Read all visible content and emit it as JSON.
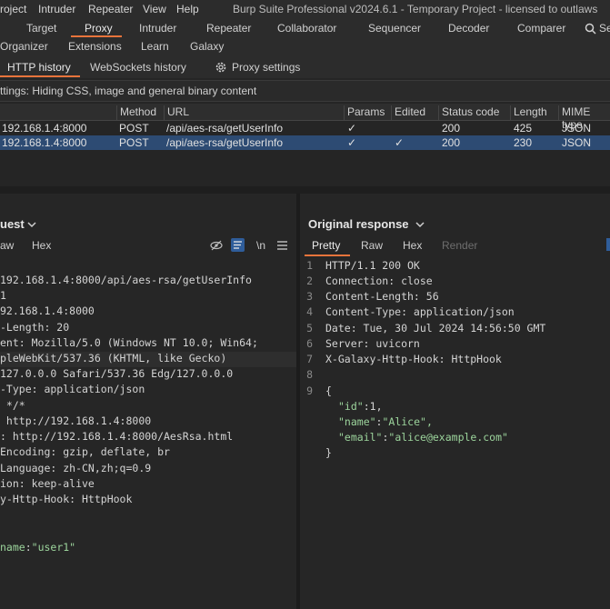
{
  "menu": {
    "items": [
      "roject",
      "Intruder",
      "Repeater",
      "View",
      "Help"
    ],
    "title": "Burp Suite Professional v2024.6.1 - Temporary Project - licensed to outlaws"
  },
  "top_tabs": {
    "items": [
      "Target",
      "Proxy",
      "Intruder",
      "Repeater",
      "Collaborator",
      "Sequencer",
      "Decoder",
      "Comparer"
    ],
    "search_text": "Se"
  },
  "sub_tabs": [
    "Organizer",
    "Extensions",
    "Learn",
    "Galaxy"
  ],
  "proxy_tabs": {
    "http_history": "HTTP history",
    "websockets": "WebSockets history",
    "settings": "Proxy settings"
  },
  "filter_text": "ttings: Hiding CSS, image and general binary content",
  "history_table": {
    "headers": [
      "Method",
      "URL",
      "Params",
      "Edited",
      "Status code",
      "Length",
      "MIME type"
    ],
    "rows": [
      {
        "host": "192.168.1.4:8000",
        "method": "POST",
        "url": "/api/aes-rsa/getUserInfo",
        "params": "✓",
        "edited": "",
        "status": "200",
        "length": "425",
        "mime": "JSON"
      },
      {
        "host": "192.168.1.4:8000",
        "method": "POST",
        "url": "/api/aes-rsa/getUserInfo",
        "params": "✓",
        "edited": "✓",
        "status": "200",
        "length": "230",
        "mime": "JSON"
      }
    ]
  },
  "request_pane": {
    "title": "uest",
    "tabs": [
      "aw",
      "Hex"
    ],
    "wrap_icon_text": "\\n",
    "lines": [
      "192.168.1.4:8000/api/aes-rsa/getUserInfo",
      "1",
      "92.168.1.4:8000",
      "-Length: 20",
      "ent: Mozilla/5.0 (Windows NT 10.0; Win64;",
      "pleWebKit/537.36 (KHTML, like Gecko)",
      "127.0.0.0 Safari/537.36 Edg/127.0.0.0",
      "-Type: application/json",
      " */*",
      " http://192.168.1.4:8000",
      ": http://192.168.1.4:8000/AesRsa.html",
      "Encoding: gzip, deflate, br",
      "Language: zh-CN,zh;q=0.9",
      "ion: keep-alive",
      "y-Http-Hook: HttpHook"
    ],
    "body_key": "name",
    "body_value": "\"user1\""
  },
  "response_pane": {
    "title": "Original response",
    "tabs": [
      "Pretty",
      "Raw",
      "Hex",
      "Render"
    ],
    "lines": [
      {
        "n": "1",
        "t": "HTTP/1.1 200 OK"
      },
      {
        "n": "2",
        "t": "Connection: close"
      },
      {
        "n": "3",
        "t": "Content-Length: 56"
      },
      {
        "n": "4",
        "t": "Content-Type: application/json"
      },
      {
        "n": "5",
        "t": "Date: Tue, 30 Jul 2024 14:56:50 GMT"
      },
      {
        "n": "6",
        "t": "Server: uvicorn"
      },
      {
        "n": "7",
        "t": "X-Galaxy-Http-Hook: HttpHook"
      },
      {
        "n": "8",
        "t": ""
      },
      {
        "n": "9",
        "t": "{"
      }
    ],
    "json_lines": [
      {
        "k": "\"id\"",
        "v": "1,"
      },
      {
        "k": "\"name\"",
        "v": "\"Alice\","
      },
      {
        "k": "\"email\"",
        "v": "\"alice@example.com\""
      }
    ],
    "close_brace": "}"
  },
  "colors": {
    "accent": "#e8743b",
    "selected_row": "#2d4b73",
    "json": "#9cd49c"
  }
}
